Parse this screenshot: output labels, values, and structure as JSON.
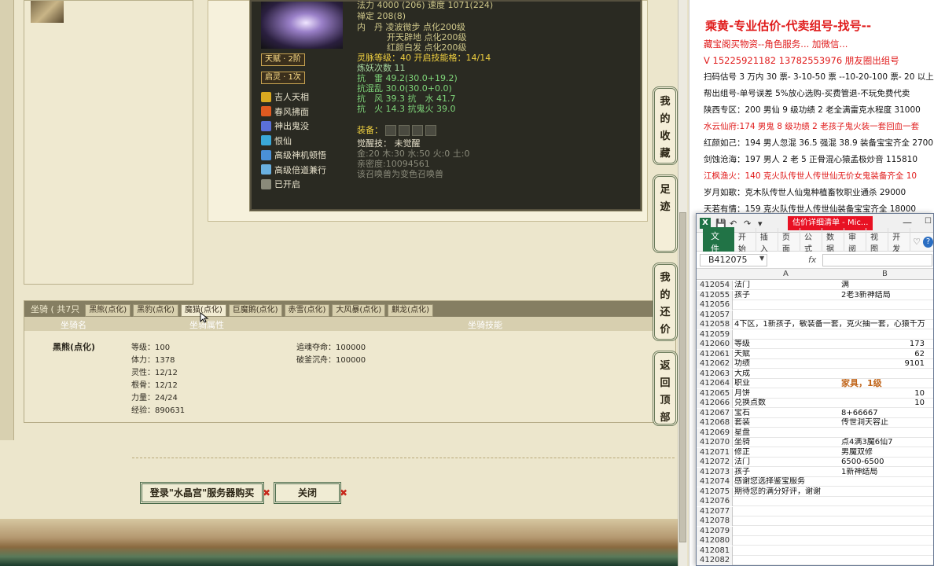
{
  "game": {
    "skill_panel": {
      "talent": "天赋 · 2阶",
      "spirit": "启灵 · 1次",
      "skills": [
        {
          "label": "吉人天相",
          "icon": "luck-icon",
          "color": "#d8a820"
        },
        {
          "label": "春风拂面",
          "icon": "wind-icon",
          "color": "#e05a20"
        },
        {
          "label": "神出鬼没",
          "icon": "ghost-icon",
          "color": "#5a70d8"
        },
        {
          "label": "恨仙",
          "icon": "ring-icon",
          "color": "#3aa8d8"
        },
        {
          "label": "高级神机顿悟",
          "icon": "gear-icon",
          "color": "#4a90d8"
        },
        {
          "label": "高级倍道兼行",
          "icon": "feather-icon",
          "color": "#6ab0e0"
        },
        {
          "label": "已开启",
          "icon": "book-icon",
          "color": "#8a8a7a"
        }
      ],
      "stats": {
        "magic": "法力 4000 (206) 速度 1071(224)",
        "zen": "禅定 208(8)",
        "inner1": "内　丹 凌波微步 点化200级",
        "inner2": "开天辟地 点化200级",
        "inner3": "红颜白发 点化200级",
        "spirit_level": "灵脉等级：40 开启技能格：14/14",
        "refine": "炼妖次数 11",
        "res1": "抗　雷 49.2(30.0+19.2)",
        "res2": "抗混乱 30.0(30.0+0.0)",
        "res3": "抗　风 39.3 抗　水 41.7",
        "res4": "抗　火 14.3 抗鬼火 39.0",
        "equip_label": "装备：",
        "awaken": "觉醒技：  未觉醒",
        "elements": "金:20 木:30 水:50 火:0 土:0",
        "intimacy": "亲密度:10094561",
        "summon_note": "该召唤兽为变色召唤兽"
      }
    },
    "mount": {
      "title": "坐骑 ( 共7只",
      "tabs": [
        "黑熊(点化)",
        "黑豹(点化)",
        "魔猫(点化)",
        "巨魔鹅(点化)",
        "赤雪(点化)",
        "大风暴(点化)",
        "麒龙(点化)"
      ],
      "headers": {
        "name": "坐骑名",
        "attr": "坐骑属性",
        "skill": "坐骑技能"
      },
      "name": "黑熊(点化)",
      "attrs": [
        "等级：100",
        "体力：1378",
        "灵性：12/12",
        "根骨：12/12",
        "力量：24/24",
        "经验：890631"
      ],
      "skills": [
        "追魂夺命：100000",
        "破釜沉舟：100000"
      ]
    },
    "buttons": {
      "buy": "登录\"水晶宫\"服务器购买",
      "close": "关闭"
    },
    "sidenav": [
      "我的收藏",
      "足迹",
      "我的还价",
      "返回顶部"
    ]
  },
  "doc": {
    "title": "乘黄-专业估价-代卖组号-找号--",
    "lines": [
      {
        "text": "藏宝阁买物资--角色服务... 加微信...",
        "red": true
      },
      {
        "text": "V 15225921182   13782553976 朋友圈出组号",
        "red": true
      },
      {
        "text": "扫码估号 3 万内 30 票- 3-10-50 票 --10-20-100 票- 20 以上 1",
        "red": false
      },
      {
        "text": "帮出组号-单号误差 5%放心选购-买费管退-不玩免费代卖",
        "red": false
      },
      {
        "text": "陕西专区：200 男仙 9 级功绩 2 老全满雷克水程度 31000",
        "red": false
      },
      {
        "text": "水云仙府:174 男鬼 8 级功绩 2 老孩子鬼火装一套回血一套",
        "red": true
      },
      {
        "text": "红颜如己：194 男人忽混 36.5 强混 38.9 装备宝宝齐全 2700",
        "red": false
      },
      {
        "text": "剑蚀沧海：197 男人 2 老 5 正骨混心猿孟极炒音 115810",
        "red": false
      },
      {
        "text": "江枫渔火：140 克火队传世人传世仙无价女鬼装备齐全 10",
        "red": true
      },
      {
        "text": "岁月如歌：克木队传世人仙鬼种植畜牧职业通杀 29000",
        "red": false
      },
      {
        "text": "天若有情：159 克火队传世人传世仙装备宝宝齐全 18000",
        "red": false
      }
    ]
  },
  "excel": {
    "doc_title": "估价详细清单 - Mic...",
    "ribbon_tabs": [
      "开始",
      "插入",
      "页面",
      "公式",
      "数据",
      "审阅",
      "视图",
      "开发"
    ],
    "file_tab": "文件",
    "name_box": "B412075",
    "fx": "fx",
    "col_a": "A",
    "col_b": "B",
    "rows": [
      {
        "n": "412054",
        "a": "法门",
        "b": "满"
      },
      {
        "n": "412055",
        "a": "孩子",
        "b": "2老3新神结局"
      },
      {
        "n": "412056",
        "a": "",
        "b": ""
      },
      {
        "n": "412057",
        "a": "",
        "b": ""
      },
      {
        "n": "412058",
        "span": "4下区，1新孩子，敏装备一套，克火抽一套，心猿千万"
      },
      {
        "n": "412059",
        "a": "",
        "b": ""
      },
      {
        "n": "412060",
        "a": "等级",
        "b": "173",
        "right": true
      },
      {
        "n": "412061",
        "a": "天赋",
        "b": "62",
        "right": true
      },
      {
        "n": "412062",
        "a": "功绩",
        "b": "9101",
        "right": true
      },
      {
        "n": "412063",
        "a": "大成",
        "b": ""
      },
      {
        "n": "412064",
        "a": "职业",
        "b": "家具，1级",
        "orange": true
      },
      {
        "n": "412065",
        "a": "月饼",
        "b": "10",
        "right": true
      },
      {
        "n": "412066",
        "a": "兑换点数",
        "b": "10",
        "right": true
      },
      {
        "n": "412067",
        "a": "宝石",
        "b": "8+66667"
      },
      {
        "n": "412068",
        "a": "套装",
        "b": "传世洞天容止"
      },
      {
        "n": "412069",
        "a": "星盘",
        "b": ""
      },
      {
        "n": "412070",
        "a": "坐骑",
        "b": "点4满3魔6仙7"
      },
      {
        "n": "412071",
        "a": "修正",
        "b": "男魔双修"
      },
      {
        "n": "412072",
        "a": "法门",
        "b": "6500-6500"
      },
      {
        "n": "412073",
        "a": "孩子",
        "b": "1新神结局"
      },
      {
        "n": "412074",
        "a": "感谢您选择鉴宝服务",
        "b": ""
      },
      {
        "n": "412075",
        "a": "期待您的满分好评，谢谢",
        "b": ""
      },
      {
        "n": "412076",
        "a": "",
        "b": ""
      },
      {
        "n": "412077",
        "a": "",
        "b": ""
      },
      {
        "n": "412078",
        "a": "",
        "b": ""
      },
      {
        "n": "412079",
        "a": "",
        "b": ""
      },
      {
        "n": "412080",
        "a": "",
        "b": ""
      },
      {
        "n": "412081",
        "a": "",
        "b": ""
      },
      {
        "n": "412082",
        "a": "",
        "b": ""
      }
    ]
  }
}
